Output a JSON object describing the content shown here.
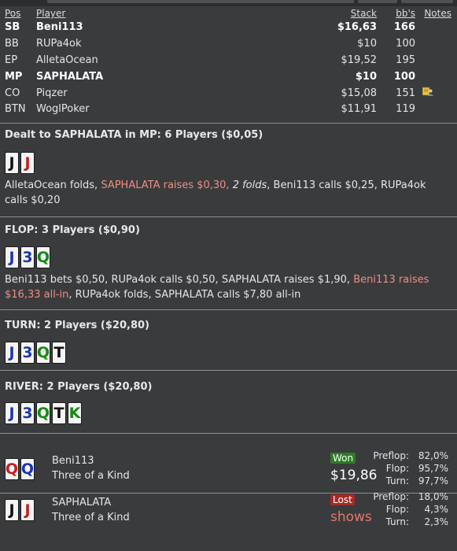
{
  "header": {
    "pos": "Pos",
    "player": "Player",
    "stack": "Stack",
    "bbs": "bb's",
    "notes": "Notes"
  },
  "players": [
    {
      "pos": "SB",
      "name": "Beni113",
      "stack": "$16,63",
      "bbs": "166",
      "bold": true
    },
    {
      "pos": "BB",
      "name": "RUPa4ok",
      "stack": "$10",
      "bbs": "100",
      "bold": false
    },
    {
      "pos": "EP",
      "name": "AlletaOcean",
      "stack": "$19,52",
      "bbs": "195",
      "bold": false
    },
    {
      "pos": "MP",
      "name": "SAPHALATA",
      "stack": "$10",
      "bbs": "100",
      "bold": true
    },
    {
      "pos": "CO",
      "name": "Piqzer",
      "stack": "$15,08",
      "bbs": "151",
      "bold": false,
      "note_icon": "note-person-icon"
    },
    {
      "pos": "BTN",
      "name": "WoglPoker",
      "stack": "$11,91",
      "bbs": "119",
      "bold": false
    }
  ],
  "preflop": {
    "title": "Dealt to SAPHALATA in MP: 6 Players ($0,05)",
    "cards": [
      {
        "rank": "J",
        "color": "black"
      },
      {
        "rank": "J",
        "color": "red"
      }
    ],
    "action": {
      "p1": "AlletaOcean folds, ",
      "p2": "SAPHALATA raises $0,30,",
      "p3": " ",
      "p4": "2 folds",
      "p5": ", Beni113 calls $0,25, RUPa4ok calls $0,20"
    }
  },
  "flop": {
    "title": "FLOP: 3 Players ($0,90)",
    "cards": [
      {
        "rank": "J",
        "color": "blue"
      },
      {
        "rank": "3",
        "color": "blue"
      },
      {
        "rank": "Q",
        "color": "green"
      }
    ],
    "action": {
      "p1": "Beni113 bets $0,50, RUPa4ok calls $0,50, SAPHALATA raises $1,90, ",
      "p2": "Beni113 raises $16,33 all-in",
      "p3": ", RUPa4ok folds, SAPHALATA calls $7,80 all-in"
    }
  },
  "turn": {
    "title": "TURN: 2 Players ($20,80)",
    "cards": [
      {
        "rank": "J",
        "color": "blue"
      },
      {
        "rank": "3",
        "color": "blue"
      },
      {
        "rank": "Q",
        "color": "green"
      },
      {
        "rank": "T",
        "color": "black"
      }
    ]
  },
  "river": {
    "title": "RIVER: 2 Players ($20,80)",
    "cards": [
      {
        "rank": "J",
        "color": "blue"
      },
      {
        "rank": "3",
        "color": "blue"
      },
      {
        "rank": "Q",
        "color": "green"
      },
      {
        "rank": "T",
        "color": "black"
      },
      {
        "rank": "K",
        "color": "green"
      }
    ]
  },
  "showdown": [
    {
      "name": "Beni113",
      "hand": "Three of a Kind",
      "cards": [
        {
          "rank": "Q",
          "color": "red"
        },
        {
          "rank": "Q",
          "color": "blue"
        }
      ],
      "result": "Won",
      "amount": "$19,86",
      "equity": [
        {
          "label": "Preflop:",
          "value": "82,0%"
        },
        {
          "label": "Flop:",
          "value": "95,7%"
        },
        {
          "label": "Turn:",
          "value": "97,7%"
        }
      ]
    },
    {
      "name": "SAPHALATA",
      "hand": "Three of a Kind",
      "cards": [
        {
          "rank": "J",
          "color": "black"
        },
        {
          "rank": "J",
          "color": "red"
        }
      ],
      "result": "Lost",
      "amount": "shows",
      "equity": [
        {
          "label": "Preflop:",
          "value": "18,0%"
        },
        {
          "label": "Flop:",
          "value": "4,3%"
        },
        {
          "label": "Turn:",
          "value": "2,3%"
        }
      ]
    }
  ],
  "colors": {
    "background": "#3a3b3d",
    "highlight": "#ee8f83",
    "won": "#2e7a28",
    "lost": "#a52a25"
  }
}
